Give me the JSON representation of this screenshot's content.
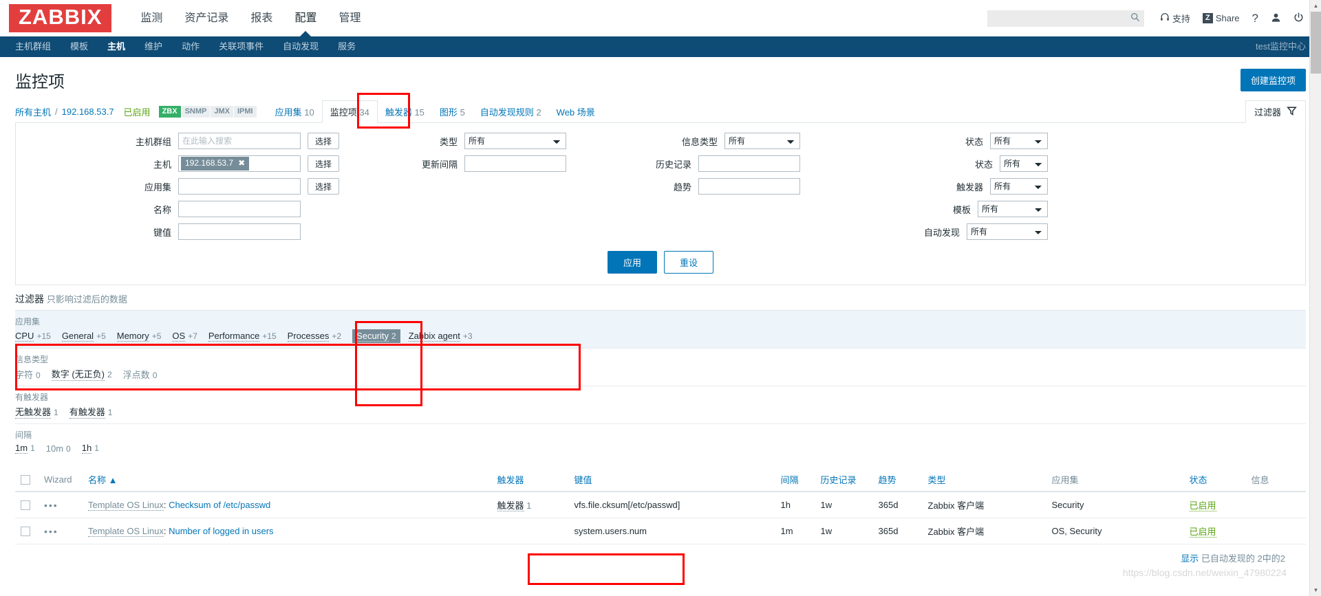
{
  "header": {
    "logo": "ZABBIX",
    "menu": [
      {
        "label": "监测",
        "selected": false
      },
      {
        "label": "资产记录",
        "selected": false
      },
      {
        "label": "报表",
        "selected": false
      },
      {
        "label": "配置",
        "selected": true
      },
      {
        "label": "管理",
        "selected": false
      }
    ],
    "search_placeholder": "",
    "search_value": "",
    "support_label": "支持",
    "share_label": "Share",
    "share_badge": "Z",
    "help_label": "?",
    "colors": {
      "logo_bg": "#e33e3e",
      "navbar": "#0e4b75",
      "accent": "#0275b8"
    }
  },
  "subnav": {
    "items": [
      {
        "label": "主机群组",
        "selected": false
      },
      {
        "label": "模板",
        "selected": false
      },
      {
        "label": "主机",
        "selected": true
      },
      {
        "label": "维护",
        "selected": false
      },
      {
        "label": "动作",
        "selected": false
      },
      {
        "label": "关联项事件",
        "selected": false
      },
      {
        "label": "自动发现",
        "selected": false
      },
      {
        "label": "服务",
        "selected": false
      }
    ],
    "right_label": "test监控中心"
  },
  "page": {
    "title": "监控项",
    "create_button": "创建监控项",
    "filter_toggle": "过滤器"
  },
  "breadcrumb": {
    "all_hosts": "所有主机",
    "separator": "/",
    "host": "192.168.53.7",
    "status": "已启用",
    "protocols": [
      {
        "label": "ZBX",
        "active": true
      },
      {
        "label": "SNMP",
        "active": false
      },
      {
        "label": "JMX",
        "active": false
      },
      {
        "label": "IPMI",
        "active": false
      }
    ],
    "tabs": [
      {
        "label": "应用集",
        "count": "10",
        "selected": false
      },
      {
        "label": "监控项",
        "count": "34",
        "selected": true
      },
      {
        "label": "触发器",
        "count": "15",
        "selected": false
      },
      {
        "label": "图形",
        "count": "5",
        "selected": false
      },
      {
        "label": "自动发现规则",
        "count": "2",
        "selected": false
      },
      {
        "label": "Web 场景",
        "count": "",
        "selected": false
      }
    ]
  },
  "filter": {
    "col1": [
      {
        "label": "主机群组",
        "type": "search",
        "value": "",
        "placeholder": "在此输入搜索",
        "button": "选择"
      },
      {
        "label": "主机",
        "type": "multiselect",
        "chip": "192.168.53.7",
        "chip_remove": "✖",
        "button": "选择"
      },
      {
        "label": "应用集",
        "type": "search",
        "value": "",
        "placeholder": "",
        "button": "选择"
      },
      {
        "label": "名称",
        "type": "text",
        "value": "",
        "placeholder": ""
      },
      {
        "label": "键值",
        "type": "text",
        "value": "",
        "placeholder": ""
      }
    ],
    "col2": [
      {
        "label": "类型",
        "type": "select",
        "value": "所有"
      },
      {
        "label": "更新间隔",
        "type": "text",
        "value": ""
      }
    ],
    "col3": [
      {
        "label": "信息类型",
        "type": "select",
        "value": "所有"
      },
      {
        "label": "历史记录",
        "type": "text",
        "value": ""
      },
      {
        "label": "趋势",
        "type": "text",
        "value": ""
      }
    ],
    "col4": [
      {
        "label": "状态",
        "type": "select",
        "value": "所有"
      },
      {
        "label": "状态",
        "type": "select",
        "value": "所有"
      },
      {
        "label": "触发器",
        "type": "select",
        "value": "所有"
      },
      {
        "label": "模板",
        "type": "select",
        "value": "所有"
      },
      {
        "label": "自动发现",
        "type": "select",
        "value": "所有"
      }
    ],
    "apply_button": "应用",
    "reset_button": "重设"
  },
  "subfilter": {
    "heading": "过滤器",
    "hint": "只影响过滤后的数据",
    "groups": [
      {
        "title": "应用集",
        "highlight": true,
        "items": [
          {
            "label": "CPU",
            "count": "+15",
            "active": false
          },
          {
            "label": "General",
            "count": "+5",
            "active": false
          },
          {
            "label": "Memory",
            "count": "+5",
            "active": false
          },
          {
            "label": "OS",
            "count": "+7",
            "active": false
          },
          {
            "label": "Performance",
            "count": "+15",
            "active": false
          },
          {
            "label": "Processes",
            "count": "+2",
            "active": false
          },
          {
            "label": "Security",
            "count": "2",
            "active": true
          },
          {
            "label": "Zabbix agent",
            "count": "+3",
            "active": false
          }
        ]
      },
      {
        "title": "信息类型",
        "highlight": false,
        "items": [
          {
            "label": "字符",
            "count": "0",
            "active": false,
            "disabled": true
          },
          {
            "label": "数字 (无正负)",
            "count": "2",
            "active": false
          },
          {
            "label": "浮点数",
            "count": "0",
            "active": false,
            "disabled": true
          }
        ]
      },
      {
        "title": "有触发器",
        "highlight": false,
        "items": [
          {
            "label": "无触发器",
            "count": "1",
            "active": false
          },
          {
            "label": "有触发器",
            "count": "1",
            "active": false
          }
        ]
      },
      {
        "title": "间隔",
        "highlight": false,
        "items": [
          {
            "label": "1m",
            "count": "1",
            "active": false
          },
          {
            "label": "10m",
            "count": "0",
            "active": false,
            "disabled": true
          },
          {
            "label": "1h",
            "count": "1",
            "active": false
          }
        ]
      }
    ]
  },
  "table": {
    "columns": [
      {
        "label": "",
        "link": false
      },
      {
        "label": "Wizard",
        "link": false
      },
      {
        "label": "名称 ▲",
        "link": true
      },
      {
        "label": "触发器",
        "link": true
      },
      {
        "label": "键值",
        "link": true
      },
      {
        "label": "间隔",
        "link": true
      },
      {
        "label": "历史记录",
        "link": true
      },
      {
        "label": "趋势",
        "link": true
      },
      {
        "label": "类型",
        "link": true
      },
      {
        "label": "应用集",
        "link": false
      },
      {
        "label": "状态",
        "link": true
      },
      {
        "label": "信息",
        "link": false
      }
    ],
    "rows": [
      {
        "wizard": "•••",
        "template": "Template OS Linux",
        "name": "Checksum of /etc/passwd",
        "trigger_label": "触发器",
        "trigger_count": "1",
        "key": "vfs.file.cksum[/etc/passwd]",
        "interval": "1h",
        "history": "1w",
        "trends": "365d",
        "type": "Zabbix 客户端",
        "applications": "Security",
        "status": "已启用",
        "info": ""
      },
      {
        "wizard": "•••",
        "template": "Template OS Linux",
        "name": "Number of logged in users",
        "trigger_label": "",
        "trigger_count": "",
        "key": "system.users.num",
        "interval": "1m",
        "history": "1w",
        "trends": "365d",
        "type": "Zabbix 客户端",
        "applications": "OS, Security",
        "status": "已启用",
        "info": ""
      }
    ],
    "footer_lead": "显示",
    "footer_text": "已自动发现的 2中的2"
  },
  "watermark": "https://blog.csdn.net/weixin_47980224"
}
